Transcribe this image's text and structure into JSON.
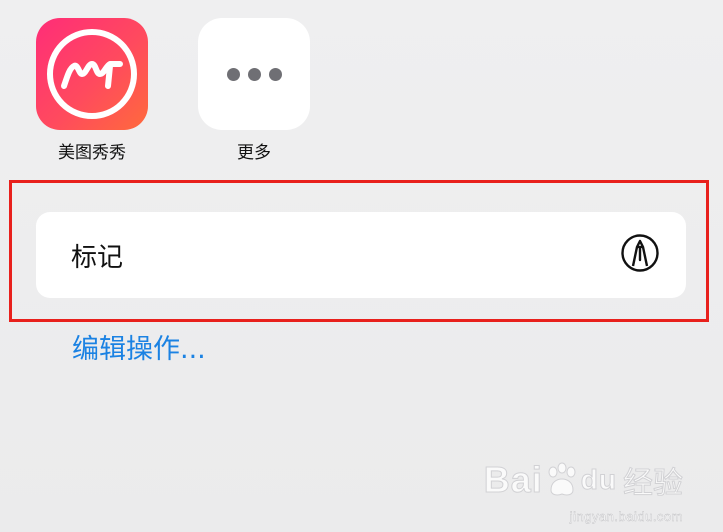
{
  "share_sheet": {
    "apps": [
      {
        "label": "美图秀秀",
        "icon": "meitu-app-icon"
      },
      {
        "label": "更多",
        "icon": "more-dots-icon"
      }
    ],
    "action": {
      "label": "标记",
      "icon": "markup-pen-icon"
    },
    "edit_actions_link": "编辑操作..."
  },
  "watermark": {
    "brand_latin": "Bai",
    "brand_latin_suffix": "du",
    "brand_cn": "经验",
    "url": "jingyan.baidu.com"
  },
  "colors": {
    "accent_link": "#1b82e3",
    "highlight_border": "#e8201c",
    "meitu_gradient_start": "#ff2d78",
    "meitu_gradient_end": "#ff6a3c"
  }
}
